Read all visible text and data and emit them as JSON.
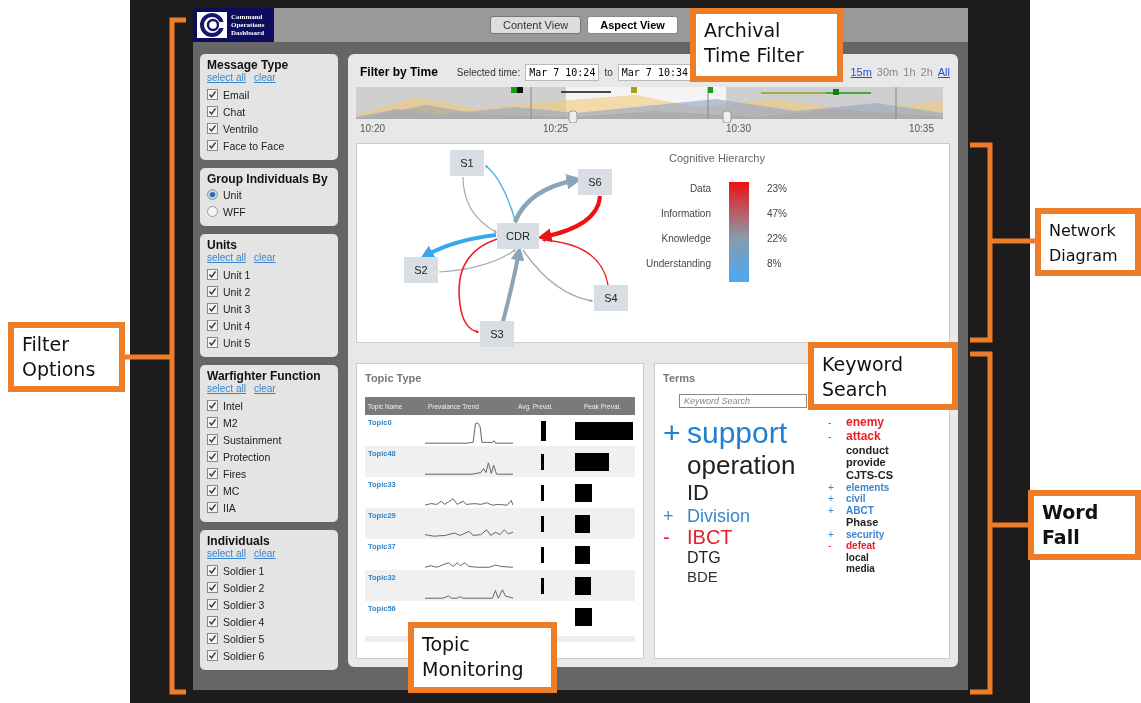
{
  "header": {
    "logo_text": "Command Operations Dashboard",
    "tabs": [
      {
        "label": "Content View",
        "selected": false
      },
      {
        "label": "Aspect View",
        "selected": true
      }
    ]
  },
  "sidebar": [
    {
      "kind": "check",
      "title": "Message Type",
      "select_all": "select all",
      "clear": "clear",
      "items": [
        {
          "label": "Email",
          "checked": true
        },
        {
          "label": "Chat",
          "checked": true
        },
        {
          "label": "Ventrilo",
          "checked": true
        },
        {
          "label": "Face to Face",
          "checked": true
        }
      ]
    },
    {
      "kind": "radio",
      "title": "Group Individuals By",
      "items": [
        {
          "label": "Unit",
          "selected": true
        },
        {
          "label": "WFF",
          "selected": false
        }
      ]
    },
    {
      "kind": "check",
      "title": "Units",
      "select_all": "select all",
      "clear": "clear",
      "items": [
        {
          "label": "Unit 1",
          "checked": true
        },
        {
          "label": "Unit 2",
          "checked": true
        },
        {
          "label": "Unit 3",
          "checked": true
        },
        {
          "label": "Unit 4",
          "checked": true
        },
        {
          "label": "Unit 5",
          "checked": true
        }
      ]
    },
    {
      "kind": "check",
      "title": "Warfighter Function",
      "select_all": "select all",
      "clear": "clear",
      "items": [
        {
          "label": "Intel",
          "checked": true
        },
        {
          "label": "M2",
          "checked": true
        },
        {
          "label": "Sustainment",
          "checked": true
        },
        {
          "label": "Protection",
          "checked": true
        },
        {
          "label": "Fires",
          "checked": true
        },
        {
          "label": "MC",
          "checked": true
        },
        {
          "label": "IIA",
          "checked": true
        }
      ]
    },
    {
      "kind": "check",
      "title": "Individuals",
      "select_all": "select all",
      "clear": "clear",
      "items": [
        {
          "label": "Soldier 1",
          "checked": true
        },
        {
          "label": "Soldier 2",
          "checked": true
        },
        {
          "label": "Soldier 3",
          "checked": true
        },
        {
          "label": "Soldier 4",
          "checked": true
        },
        {
          "label": "Soldier 5",
          "checked": true
        },
        {
          "label": "Soldier 6",
          "checked": true
        }
      ]
    }
  ],
  "time_filter": {
    "title": "Filter by Time",
    "selected_label": "Selected time:",
    "from": "Mar 7 10:24",
    "to_label": "to",
    "to": "Mar 7 10:34",
    "ranges": [
      {
        "label": "15m",
        "selected": true
      },
      {
        "label": "30m",
        "selected": false
      },
      {
        "label": "1h",
        "selected": false
      },
      {
        "label": "2h",
        "selected": false
      },
      {
        "label": "All",
        "selected": true
      }
    ],
    "ticks": [
      "10:20",
      "10:25",
      "10:30",
      "10:35"
    ]
  },
  "network": {
    "nodes": [
      "S1",
      "S6",
      "CDR",
      "S2",
      "S4",
      "S3"
    ],
    "edges": [
      {
        "color": "#4ab0e6"
      },
      {
        "color": "#a8a8a8"
      },
      {
        "color": "#8aa5b8"
      },
      {
        "color": "#ee1111"
      },
      {
        "color": "#3aa8e8"
      },
      {
        "color": "#a8a8a8"
      },
      {
        "color": "#ee2222"
      },
      {
        "color": "#a8a8a8"
      },
      {
        "color": "#ee2222"
      },
      {
        "color": "#8aa5b8"
      }
    ],
    "legend": {
      "title": "Cognitive Hierarchy",
      "rows": [
        {
          "label": "Data",
          "value": "23%"
        },
        {
          "label": "Information",
          "value": "47%"
        },
        {
          "label": "Knowledge",
          "value": "22%"
        },
        {
          "label": "Understanding",
          "value": "8%"
        }
      ]
    }
  },
  "topics": {
    "title": "Topic Type",
    "columns": [
      "Topic Name",
      "Prevalance Trend",
      "Avg. Preval.",
      "Peak Preval."
    ],
    "rows": [
      {
        "name": "Topic0"
      },
      {
        "name": "Topic48"
      },
      {
        "name": "Topic33"
      },
      {
        "name": "Topic29"
      },
      {
        "name": "Topic37"
      },
      {
        "name": "Topic32"
      },
      {
        "name": "Topic56"
      }
    ]
  },
  "terms": {
    "title": "Terms",
    "search": {
      "placeholder": "Keyword Search"
    },
    "main": [
      {
        "sign": "+",
        "text": "support",
        "color": "#1f7fd0"
      },
      {
        "text": "operation",
        "color": "#222222"
      },
      {
        "text": "ID",
        "color": "#222222"
      },
      {
        "sign": "+",
        "text": "Division",
        "color": "#3a86cc"
      },
      {
        "sign": "-",
        "text": "IBCT",
        "color": "#e8202a"
      },
      {
        "text": "DTG",
        "color": "#222222"
      },
      {
        "text": "BDE",
        "color": "#333333"
      }
    ],
    "minor": [
      {
        "sign": "-",
        "text": "enemy",
        "color": "#e8202a"
      },
      {
        "sign": "-",
        "text": "attack",
        "color": "#e8202a"
      },
      {
        "text": "conduct",
        "color": "#222222"
      },
      {
        "text": "provide",
        "color": "#222222"
      },
      {
        "text": "CJTS-CS",
        "color": "#222222"
      },
      {
        "sign": "+",
        "text": "elements",
        "color": "#3a86cc"
      },
      {
        "sign": "+",
        "text": "civil",
        "color": "#3a86cc"
      },
      {
        "sign": "+",
        "text": "ABCT",
        "color": "#3a86cc"
      },
      {
        "text": "Phase",
        "color": "#222222"
      },
      {
        "sign": "+",
        "text": "security",
        "color": "#3a86cc"
      },
      {
        "sign": "-",
        "text": "defeat",
        "color": "#e8202a"
      },
      {
        "text": "local",
        "color": "#222222"
      },
      {
        "text": "media",
        "color": "#222222"
      }
    ]
  },
  "callouts": [
    "Filter Options",
    "Archival Time Filter",
    "Network Diagram",
    "Keyword Search",
    "Word Fall",
    "Topic Monitoring"
  ]
}
